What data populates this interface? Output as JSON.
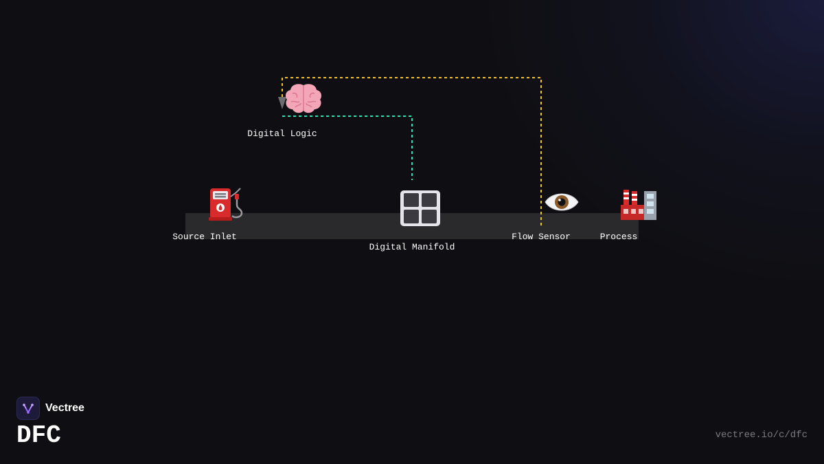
{
  "diagram": {
    "nodes": {
      "source_inlet": {
        "label": "Source Inlet",
        "icon": "fuel-pump-icon"
      },
      "digital_logic": {
        "label": "Digital Logic",
        "icon": "brain-icon"
      },
      "digital_manifold": {
        "label": "Digital Manifold",
        "icon": "manifold-grid-icon"
      },
      "flow_sensor": {
        "label": "Flow Sensor",
        "icon": "eye-icon"
      },
      "process": {
        "label": "Process",
        "icon": "factory-icon"
      }
    },
    "connections": [
      {
        "from": "flow_sensor",
        "to": "digital_logic",
        "style": "dashed",
        "color": "#f5c518"
      },
      {
        "from": "digital_logic",
        "to": "digital_manifold",
        "style": "dashed",
        "color": "#1de9b6"
      }
    ],
    "pipe_color": "#2a2a2c"
  },
  "branding": {
    "brand_name": "Vectree",
    "title": "DFC",
    "url": "vectree.io/c/dfc",
    "logo_icon": "vectree-logo-icon",
    "logo_color": "#9b6bff"
  },
  "colors": {
    "background": "#0f0f13",
    "feedback_line": "#f5c518",
    "control_line": "#1de9b6",
    "label_text": "#ffffff",
    "url_text": "#7a7a80"
  }
}
